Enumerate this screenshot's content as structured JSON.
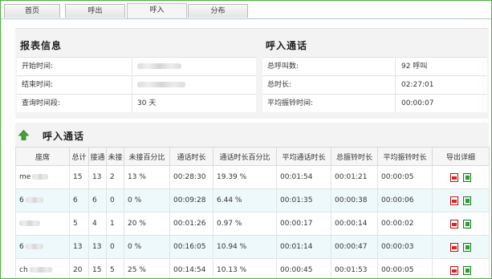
{
  "tabs": [
    {
      "label": "首页"
    },
    {
      "label": "呼出"
    },
    {
      "label": "呼入"
    },
    {
      "label": "分布"
    }
  ],
  "report_info": {
    "title": "报表信息",
    "rows": [
      {
        "label": "开始时间:"
      },
      {
        "label": "结束时间:"
      },
      {
        "label": "查询时间段:",
        "value": "30 天"
      }
    ]
  },
  "inbound_summary": {
    "title": "呼入通话",
    "rows": [
      {
        "label": "总呼叫数:",
        "value": "92 呼叫"
      },
      {
        "label": "总时长:",
        "value": "02:27:01"
      },
      {
        "label": "平均振铃时间:",
        "value": "00:00:07"
      }
    ]
  },
  "inbound_table": {
    "title": "呼入通话",
    "headers": [
      "座席",
      "总计",
      "接通",
      "未接",
      "未接百分比",
      "通话时长",
      "通话时长百分比",
      "平均通话时长",
      "总振铃时长",
      "平均振铃时长",
      "导出详细"
    ],
    "rows": [
      {
        "agent": "me",
        "total": "15",
        "answered": "13",
        "missed": "2",
        "missed_pct": "13 %",
        "talk": "00:28:30",
        "talk_pct": "19.39 %",
        "avg_talk": "00:01:54",
        "ring": "00:01:21",
        "avg_ring": "00:00:05"
      },
      {
        "agent": "6",
        "total": "6",
        "answered": "6",
        "missed": "0",
        "missed_pct": "0 %",
        "talk": "00:09:28",
        "talk_pct": "6.44 %",
        "avg_talk": "00:01:35",
        "ring": "00:00:38",
        "avg_ring": "00:00:06"
      },
      {
        "agent": "",
        "total": "5",
        "answered": "4",
        "missed": "1",
        "missed_pct": "20 %",
        "talk": "00:01:26",
        "talk_pct": "0.97 %",
        "avg_talk": "00:00:17",
        "ring": "00:00:14",
        "avg_ring": "00:00:02"
      },
      {
        "agent": "6",
        "total": "13",
        "answered": "13",
        "missed": "0",
        "missed_pct": "0 %",
        "talk": "00:16:05",
        "talk_pct": "10.94 %",
        "avg_talk": "00:01:14",
        "ring": "00:00:47",
        "avg_ring": "00:00:03"
      },
      {
        "agent": "ch",
        "total": "20",
        "answered": "15",
        "missed": "5",
        "missed_pct": "25 %",
        "talk": "00:14:54",
        "talk_pct": "10.13 %",
        "avg_talk": "00:00:45",
        "ring": "00:01:53",
        "avg_ring": "00:00:05"
      }
    ]
  },
  "icons": {
    "collapse": "green-up-arrow-icon",
    "export_pdf": "pdf-file-icon",
    "export_excel": "excel-file-icon"
  },
  "colors": {
    "frame_border": "#4cb13d",
    "row_alt": "#eef9fb",
    "panel_bg": "#f3f3f3"
  }
}
